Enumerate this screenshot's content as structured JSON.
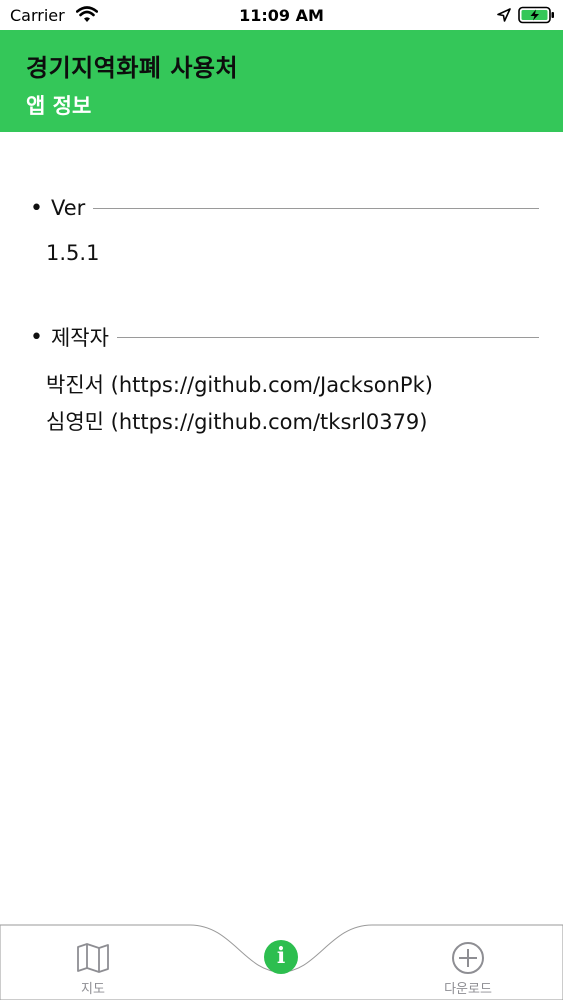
{
  "status_bar": {
    "carrier": "Carrier",
    "time": "11:09 AM",
    "wifi_icon": "wifi-icon",
    "location_icon": "location-arrow-icon",
    "battery_icon": "battery-charging-icon"
  },
  "header": {
    "title": "경기지역화폐 사용처",
    "subtitle": "앱 정보",
    "background_color": "#34c759"
  },
  "sections": {
    "version": {
      "bullet": "•",
      "label": "Ver",
      "value": "1.5.1"
    },
    "makers": {
      "bullet": "•",
      "label": "제작자",
      "lines": [
        "박진서 (https://github.com/JacksonPk)",
        "심영민 (https://github.com/tksrl0379)"
      ]
    }
  },
  "tab_bar": {
    "items": [
      {
        "label": "지도",
        "icon": "map-icon"
      },
      {
        "label": "",
        "icon": "info-icon",
        "glyph": "i",
        "selected": true
      },
      {
        "label": "다운로드",
        "icon": "plus-circle-icon"
      }
    ],
    "accent_color": "#2dbe4f"
  }
}
